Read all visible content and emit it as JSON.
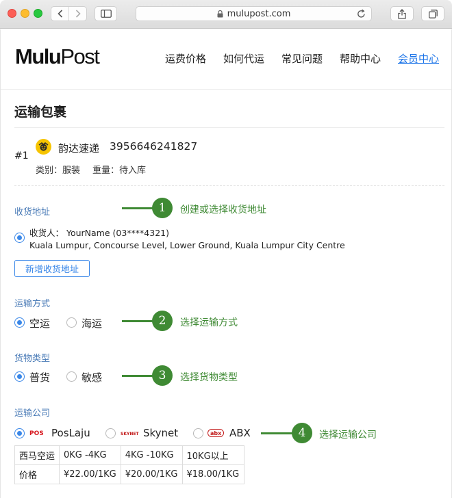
{
  "browser": {
    "url": "mulupost.com"
  },
  "header": {
    "logo_bold": "Mulu",
    "logo_light": "Post",
    "nav": [
      "运费价格",
      "如何代运",
      "常见问题",
      "帮助中心",
      "会员中心"
    ]
  },
  "page": {
    "title": "运输包裹"
  },
  "parcel": {
    "index": "#1",
    "carrier": "韵达速递",
    "tracking_number": "3956646241827",
    "category": "类别：服装",
    "weight": "重量：待入库"
  },
  "address": {
    "label": "收货地址",
    "recipient": "收货人： YourName (03****4321)",
    "line": "Kuala Lumpur, Concourse Level, Lower Ground, Kuala Lumpur City Centre",
    "add_button": "新增收货地址"
  },
  "shipping_method": {
    "label": "运输方式",
    "options": [
      "空运",
      "海运"
    ],
    "selected": "空运"
  },
  "goods_type": {
    "label": "货物类型",
    "options": [
      "普货",
      "敏感"
    ],
    "selected": "普货"
  },
  "courier": {
    "label": "运输公司",
    "options": [
      {
        "name": "PosLaju",
        "logo_text": "POS"
      },
      {
        "name": "Skynet",
        "logo_text": "SKYNET"
      },
      {
        "name": "ABX",
        "logo_text": "abx"
      }
    ],
    "selected": "PosLaju"
  },
  "rate_table": {
    "rows": [
      [
        "西马空运",
        "0KG -4KG",
        "4KG -10KG",
        "10KG以上"
      ],
      [
        "价格",
        "¥22.00/1KG",
        "¥20.00/1KG",
        "¥18.00/1KG"
      ]
    ]
  },
  "steps": [
    {
      "number": "1",
      "text": "创建或选择收货地址"
    },
    {
      "number": "2",
      "text": "选择运输方式"
    },
    {
      "number": "3",
      "text": "选择货物类型"
    },
    {
      "number": "4",
      "text": "选择运输公司"
    }
  ],
  "colors": {
    "accent": "#3a87e8",
    "step_green": "#3f8a34",
    "section_label": "#4a7bb7",
    "link": "#1a73e8"
  }
}
